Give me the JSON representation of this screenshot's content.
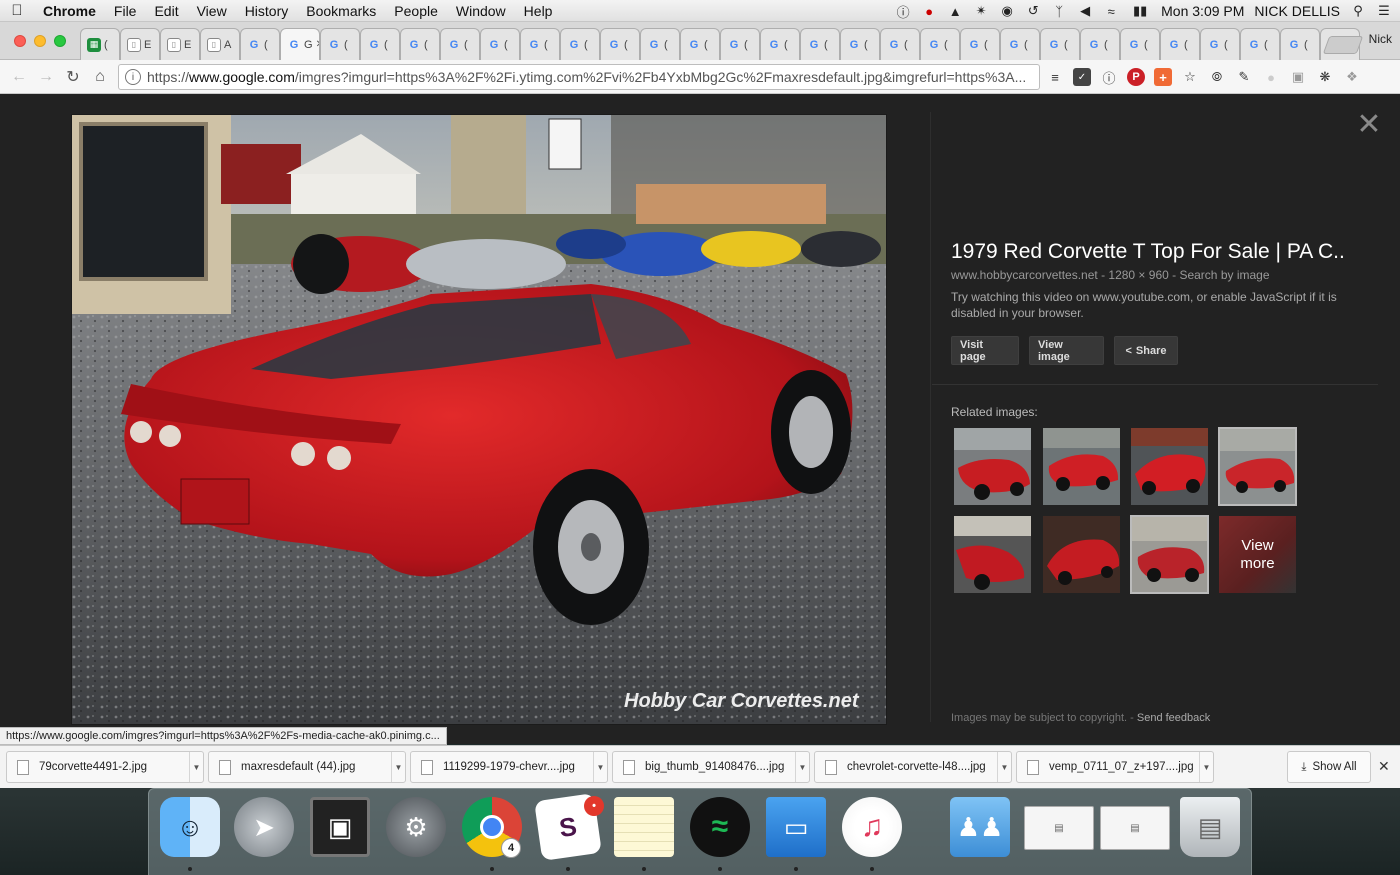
{
  "menubar": {
    "app": "Chrome",
    "items": [
      "File",
      "Edit",
      "View",
      "History",
      "Bookmarks",
      "People",
      "Window",
      "Help"
    ],
    "clock": "Mon 3:09 PM",
    "user": "NICK DELLIS"
  },
  "browser": {
    "profile": "Nick",
    "tabs": [
      {
        "icon": "sheets",
        "label": "("
      },
      {
        "icon": "doc",
        "label": "E"
      },
      {
        "icon": "doc",
        "label": "E"
      },
      {
        "icon": "doc",
        "label": "A"
      },
      {
        "icon": "google",
        "label": "("
      },
      {
        "icon": "google",
        "label": "G",
        "active": true
      },
      {
        "icon": "google",
        "label": "("
      },
      {
        "icon": "google",
        "label": "("
      },
      {
        "icon": "google",
        "label": "("
      },
      {
        "icon": "google",
        "label": "("
      },
      {
        "icon": "google",
        "label": "("
      },
      {
        "icon": "google",
        "label": "("
      },
      {
        "icon": "google",
        "label": "("
      },
      {
        "icon": "google",
        "label": "("
      },
      {
        "icon": "google",
        "label": "("
      },
      {
        "icon": "google",
        "label": "("
      },
      {
        "icon": "google",
        "label": "("
      },
      {
        "icon": "google",
        "label": "("
      },
      {
        "icon": "google",
        "label": "("
      },
      {
        "icon": "google",
        "label": "("
      },
      {
        "icon": "google",
        "label": "("
      },
      {
        "icon": "google",
        "label": "("
      },
      {
        "icon": "google",
        "label": "("
      },
      {
        "icon": "google",
        "label": "("
      },
      {
        "icon": "google",
        "label": "("
      },
      {
        "icon": "google",
        "label": "("
      },
      {
        "icon": "google",
        "label": "("
      },
      {
        "icon": "google",
        "label": "("
      },
      {
        "icon": "google",
        "label": "("
      },
      {
        "icon": "google",
        "label": "("
      },
      {
        "icon": "google",
        "label": "("
      },
      {
        "icon": "google",
        "label": "("
      }
    ],
    "url_prefix": "https://",
    "url_host": "www.google.com",
    "url_rest": "/imgres?imgurl=https%3A%2F%2Fi.ytimg.com%2Fvi%2Fb4YxbMbg2Gc%2Fmaxresdefault.jpg&imgrefurl=https%3A...",
    "extensions": [
      "buffer-icon",
      "pocket-icon",
      "info-icon",
      "pinterest-icon",
      "plus-icon",
      "star-icon",
      "compass-icon",
      "eyedropper-icon",
      "circle-icon",
      "image-icon",
      "bug-icon",
      "puzzle-icon"
    ]
  },
  "image_panel": {
    "watermark": "Hobby Car Corvettes.net",
    "title": "1979 Red Corvette T Top For Sale | PA C..",
    "meta": "www.hobbycarcorvettes.net - 1280 × 960 - Search by image",
    "note": "Try watching this video on www.youtube.com, or enable JavaScript if it is disabled in your browser.",
    "buttons": {
      "visit": "Visit page",
      "view": "View image",
      "share": "Share"
    },
    "related_label": "Related images:",
    "view_more": "View more",
    "footer_note": "Images may be subject to copyright.",
    "footer_sep": " - ",
    "footer_link": "Send feedback"
  },
  "status_url": "https://www.google.com/imgres?imgurl=https%3A%2F%2Fs-media-cache-ak0.pinimg.c...",
  "downloads": {
    "files": [
      "79corvette4491-2.jpg",
      "maxresdefault (44).jpg",
      "1119299-1979-chevr....jpg",
      "big_thumb_91408476....jpg",
      "chevrolet-corvette-l48....jpg",
      "vemp_0711_07_z+197....jpg"
    ],
    "show_all": "Show All"
  },
  "dock": {
    "chrome_badge": "4",
    "apps": [
      "finder",
      "launchpad",
      "photo-app",
      "system-preferences",
      "chrome",
      "slack",
      "notes",
      "spotify",
      "keynote",
      "itunes",
      "documents-folder",
      "window-preview-1",
      "window-preview-2",
      "trash"
    ]
  }
}
